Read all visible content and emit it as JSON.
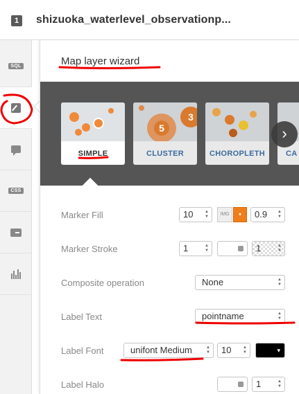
{
  "header": {
    "badge": "1",
    "title": "shizuoka_waterlevel_observationp..."
  },
  "sidebar": {
    "items": [
      {
        "name": "sql",
        "label": "SQL"
      },
      {
        "name": "wizard",
        "icon": "brush-icon"
      },
      {
        "name": "infowindow",
        "icon": "comment-icon"
      },
      {
        "name": "css",
        "label": "CSS"
      },
      {
        "name": "legend",
        "icon": "legend-icon"
      },
      {
        "name": "filters",
        "icon": "bar-chart-icon"
      }
    ]
  },
  "panel": {
    "title": "Map layer wizard",
    "wizards": [
      {
        "label": "SIMPLE",
        "selected": true
      },
      {
        "label": "CLUSTER",
        "selected": false,
        "numbers": [
          "5",
          "3"
        ]
      },
      {
        "label": "CHOROPLETH",
        "selected": false
      },
      {
        "label": "CA",
        "selected": false
      }
    ],
    "next_icon": "›"
  },
  "properties": {
    "marker_fill": {
      "label": "Marker Fill",
      "width": "10",
      "img": "IMG",
      "opacity": "0.9",
      "color": "#f07d1b"
    },
    "marker_stroke": {
      "label": "Marker Stroke",
      "width": "1",
      "opacity": "1"
    },
    "composite": {
      "label": "Composite operation",
      "value": "None"
    },
    "label_text": {
      "label": "Label Text",
      "value": "pointname"
    },
    "label_font": {
      "label": "Label Font",
      "value": "unifont Medium",
      "size": "10",
      "color": "#000000"
    },
    "label_halo": {
      "label": "Label Halo",
      "value": "1"
    }
  },
  "colors": {
    "annotation": "#e00000",
    "accent": "#f07d1b",
    "link": "#3a6b9f"
  }
}
